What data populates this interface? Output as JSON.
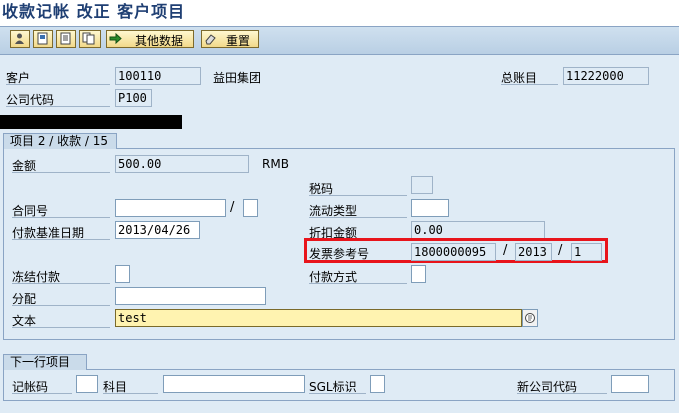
{
  "window": {
    "title": "收款记帐 改正 客户项目"
  },
  "toolbar": {
    "btn1": "",
    "btn2": "",
    "btn3": "",
    "btn4": "",
    "other_data_label": "其他数据",
    "reset_label": "重置"
  },
  "header": {
    "customer_label": "客户",
    "customer_value": "100110",
    "customer_name": "益田集团",
    "gl_label": "总账目",
    "gl_value": "11222000",
    "company_label": "公司代码",
    "company_value": "P100"
  },
  "item": {
    "group_title": "项目 2 / 收款 / 15",
    "amount_label": "金额",
    "amount_value": "500.00",
    "currency": "RMB",
    "tax_code_label": "税码",
    "tax_code_value": "",
    "contract_label": "合同号",
    "contract_value": "",
    "contract_sub_value": "",
    "flow_type_label": "流动类型",
    "flow_type_value": "",
    "baseline_date_label": "付款基准日期",
    "baseline_date_value": "2013/04/26",
    "discount_label": "折扣金额",
    "discount_value": "0.00",
    "invoice_ref_label": "发票参考号",
    "invoice_ref_number": "1800000095",
    "invoice_ref_year": "2013",
    "invoice_ref_item": "1",
    "freeze_label": "冻结付款",
    "freeze_value": "",
    "payment_method_label": "付款方式",
    "payment_method_value": "",
    "assignment_label": "分配",
    "assignment_value": "",
    "text_label": "文本",
    "text_value": "test"
  },
  "next_line": {
    "group_title": "下一行项目",
    "posting_key_label": "记帐码",
    "posting_key_value": "",
    "account_label": "科目",
    "account_value": "",
    "sgl_label": "SGL标识",
    "sgl_value": "",
    "new_company_label": "新公司代码",
    "new_company_value": ""
  },
  "colors": {
    "highlight": "#e8141b",
    "text_field": "#fff3b0"
  }
}
